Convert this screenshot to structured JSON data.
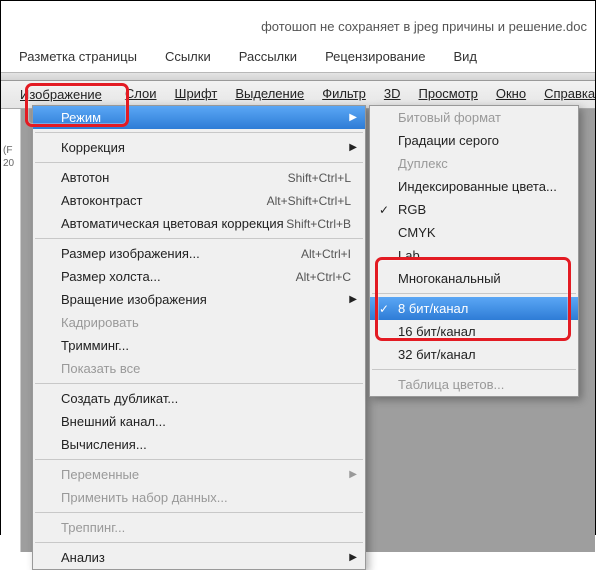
{
  "window": {
    "title": "фотошоп не сохраняет в jpeg причины и решение.doc"
  },
  "top_menu": {
    "items": [
      "Разметка страницы",
      "Ссылки",
      "Рассылки",
      "Рецензирование",
      "Вид"
    ]
  },
  "app_menu": {
    "items": [
      "Изображение",
      "Слои",
      "Шрифт",
      "Выделение",
      "Фильтр",
      "3D",
      "Просмотр",
      "Окно",
      "Справка"
    ],
    "active": "Изображение"
  },
  "gutter": {
    "l1": "(F",
    "l2": "20"
  },
  "menu_main": {
    "items": [
      {
        "label": "Режим",
        "submenu": true,
        "selected": true
      },
      {
        "sep": true
      },
      {
        "label": "Коррекция",
        "submenu": true
      },
      {
        "sep": true
      },
      {
        "label": "Автотон",
        "shortcut": "Shift+Ctrl+L"
      },
      {
        "label": "Автоконтраст",
        "shortcut": "Alt+Shift+Ctrl+L"
      },
      {
        "label": "Автоматическая цветовая коррекция",
        "shortcut": "Shift+Ctrl+B"
      },
      {
        "sep": true
      },
      {
        "label": "Размер изображения...",
        "shortcut": "Alt+Ctrl+I"
      },
      {
        "label": "Размер холста...",
        "shortcut": "Alt+Ctrl+C"
      },
      {
        "label": "Вращение изображения",
        "submenu": true
      },
      {
        "label": "Кадрировать",
        "disabled": true
      },
      {
        "label": "Тримминг..."
      },
      {
        "label": "Показать все",
        "disabled": true
      },
      {
        "sep": true
      },
      {
        "label": "Создать дубликат..."
      },
      {
        "label": "Внешний канал..."
      },
      {
        "label": "Вычисления..."
      },
      {
        "sep": true
      },
      {
        "label": "Переменные",
        "submenu": true,
        "disabled": true
      },
      {
        "label": "Применить набор данных...",
        "disabled": true
      },
      {
        "sep": true
      },
      {
        "label": "Треппинг...",
        "disabled": true
      },
      {
        "sep": true
      },
      {
        "label": "Анализ",
        "submenu": true
      }
    ]
  },
  "menu_sub": {
    "items": [
      {
        "label": "Битовый формат",
        "disabled": true
      },
      {
        "label": "Градации серого"
      },
      {
        "label": "Дуплекс",
        "disabled": true
      },
      {
        "label": "Индексированные цвета..."
      },
      {
        "label": "RGB",
        "checked": true
      },
      {
        "label": "CMYK"
      },
      {
        "label": "Lab"
      },
      {
        "label": "Многоканальный"
      },
      {
        "sep": true
      },
      {
        "label": "8 бит/канал",
        "checked": true,
        "selected": true
      },
      {
        "label": "16 бит/канал"
      },
      {
        "label": "32 бит/канал"
      },
      {
        "sep": true
      },
      {
        "label": "Таблица цветов...",
        "disabled": true
      }
    ]
  }
}
